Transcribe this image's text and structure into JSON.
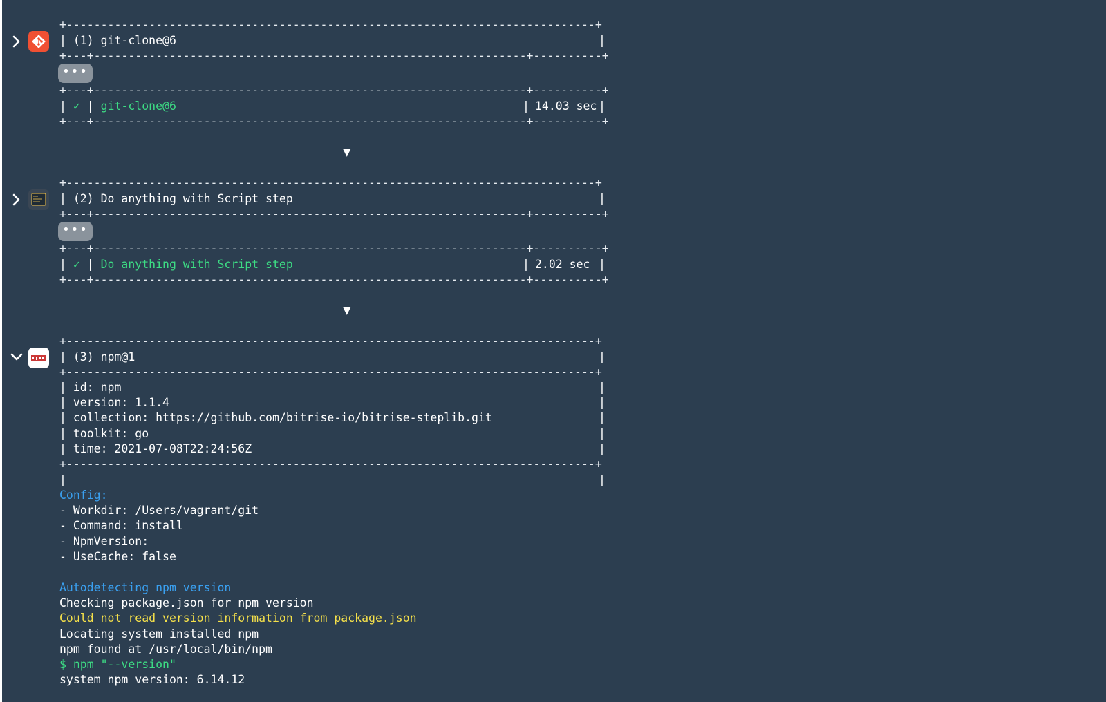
{
  "steps": [
    {
      "index_label": "(1)",
      "title": "git-clone@6",
      "expanded": false,
      "icon": "git-icon",
      "more_label": "•••",
      "status_mark": "✓",
      "summary_title": "git-clone@6",
      "duration": "14.03 sec"
    },
    {
      "index_label": "(2)",
      "title": "Do anything with Script step",
      "expanded": false,
      "icon": "script-icon",
      "more_label": "•••",
      "status_mark": "✓",
      "summary_title": "Do anything with Script step",
      "duration": "2.02 sec"
    },
    {
      "index_label": "(3)",
      "title": "npm@1",
      "expanded": true,
      "icon": "npm-icon",
      "info": {
        "id": "id: npm",
        "version": "version: 1.1.4",
        "collection": "collection: https://github.com/bitrise-io/bitrise-steplib.git",
        "toolkit": "toolkit: go",
        "time": "time: 2021-07-08T22:24:56Z"
      }
    }
  ],
  "flow_arrow": "▼",
  "npm_log": {
    "config_header": "Config:",
    "config_lines": [
      "- Workdir: /Users/vagrant/git",
      "- Command: install",
      "- NpmVersion:",
      "- UseCache: false"
    ],
    "autodetect_header": "Autodetecting npm version",
    "line_checking": "Checking package.json for npm version",
    "line_warning": "Could not read version information from package.json",
    "line_locating": "Locating system installed npm",
    "line_found": "npm found at /usr/local/bin/npm",
    "line_command": "$ npm \"--version\"",
    "line_version": "system npm version: 6.14.12"
  },
  "colors": {
    "background": "#2c3e50",
    "success": "#3ddc84",
    "info": "#3aa0f0",
    "warning": "#f5e04a",
    "git_brand": "#f05033",
    "npm_brand": "#cb3837"
  }
}
